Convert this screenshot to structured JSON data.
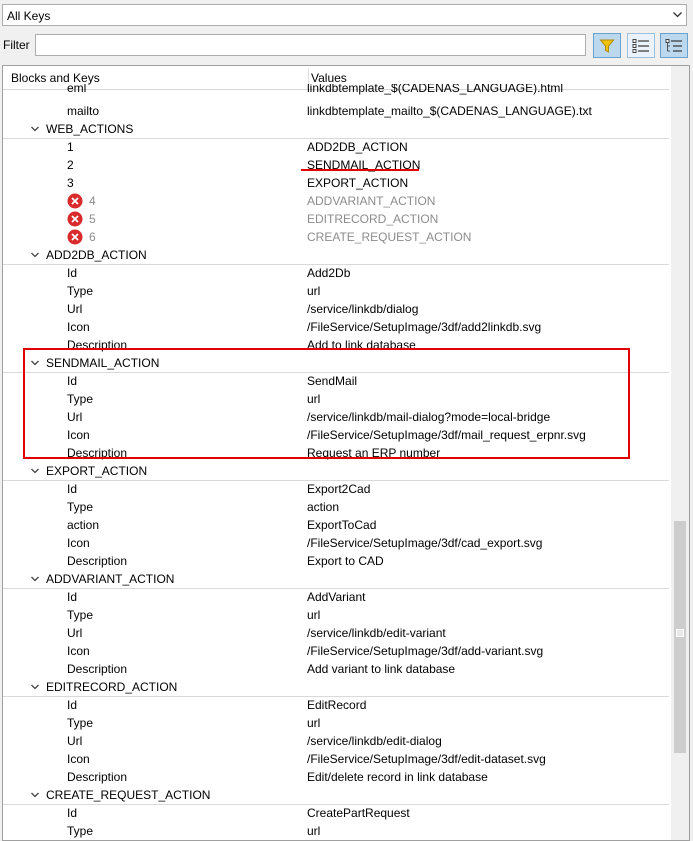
{
  "keyset": {
    "selected": "All Keys"
  },
  "filter": {
    "label": "Filter",
    "value": ""
  },
  "toolbar": {
    "funnel_icon": "filter-funnel-icon",
    "list_icon": "list-view-icon",
    "tree_icon": "tree-view-icon"
  },
  "columns": {
    "keys": "Blocks and Keys",
    "values": "Values"
  },
  "annotation_color": "#e00000",
  "rows": [
    {
      "kind": "child",
      "key": "eml",
      "value": "linkdbtemplate_$(CADENAS_LANGUAGE).html"
    },
    {
      "kind": "child",
      "key": "mailto",
      "value": "linkdbtemplate_mailto_$(CADENAS_LANGUAGE).txt"
    },
    {
      "kind": "group",
      "key": "WEB_ACTIONS",
      "value": ""
    },
    {
      "kind": "child",
      "key": "1",
      "value": "ADD2DB_ACTION"
    },
    {
      "kind": "child",
      "key": "2",
      "value": "SENDMAIL_ACTION"
    },
    {
      "kind": "child",
      "key": "3",
      "value": "EXPORT_ACTION"
    },
    {
      "kind": "error",
      "key": "4",
      "value": "ADDVARIANT_ACTION"
    },
    {
      "kind": "error",
      "key": "5",
      "value": "EDITRECORD_ACTION"
    },
    {
      "kind": "error",
      "key": "6",
      "value": "CREATE_REQUEST_ACTION"
    },
    {
      "kind": "group",
      "key": "ADD2DB_ACTION",
      "value": ""
    },
    {
      "kind": "child",
      "key": "Id",
      "value": "Add2Db"
    },
    {
      "kind": "child",
      "key": "Type",
      "value": "url"
    },
    {
      "kind": "child",
      "key": "Url",
      "value": "/service/linkdb/dialog"
    },
    {
      "kind": "child",
      "key": "Icon",
      "value": "/FileService/SetupImage/3df/add2linkdb.svg"
    },
    {
      "kind": "child",
      "key": "Description",
      "value": "Add to link database"
    },
    {
      "kind": "group",
      "key": "SENDMAIL_ACTION",
      "value": ""
    },
    {
      "kind": "child",
      "key": "Id",
      "value": "SendMail"
    },
    {
      "kind": "child",
      "key": "Type",
      "value": "url"
    },
    {
      "kind": "child",
      "key": "Url",
      "value": "/service/linkdb/mail-dialog?mode=local-bridge"
    },
    {
      "kind": "child",
      "key": "Icon",
      "value": "/FileService/SetupImage/3df/mail_request_erpnr.svg"
    },
    {
      "kind": "child",
      "key": "Description",
      "value": "Request an ERP number"
    },
    {
      "kind": "group",
      "key": "EXPORT_ACTION",
      "value": ""
    },
    {
      "kind": "child",
      "key": "Id",
      "value": "Export2Cad"
    },
    {
      "kind": "child",
      "key": "Type",
      "value": "action"
    },
    {
      "kind": "child",
      "key": "action",
      "value": "ExportToCad"
    },
    {
      "kind": "child",
      "key": "Icon",
      "value": "/FileService/SetupImage/3df/cad_export.svg"
    },
    {
      "kind": "child",
      "key": "Description",
      "value": "Export to CAD"
    },
    {
      "kind": "group",
      "key": "ADDVARIANT_ACTION",
      "value": ""
    },
    {
      "kind": "child",
      "key": "Id",
      "value": "AddVariant"
    },
    {
      "kind": "child",
      "key": "Type",
      "value": "url"
    },
    {
      "kind": "child",
      "key": "Url",
      "value": "/service/linkdb/edit-variant"
    },
    {
      "kind": "child",
      "key": "Icon",
      "value": "/FileService/SetupImage/3df/add-variant.svg"
    },
    {
      "kind": "child",
      "key": "Description",
      "value": "Add variant to link database"
    },
    {
      "kind": "group",
      "key": "EDITRECORD_ACTION",
      "value": ""
    },
    {
      "kind": "child",
      "key": "Id",
      "value": "EditRecord"
    },
    {
      "kind": "child",
      "key": "Type",
      "value": "url"
    },
    {
      "kind": "child",
      "key": "Url",
      "value": "/service/linkdb/edit-dialog"
    },
    {
      "kind": "child",
      "key": "Icon",
      "value": "/FileService/SetupImage/3df/edit-dataset.svg"
    },
    {
      "kind": "child",
      "key": "Description",
      "value": "Edit/delete record in link database"
    },
    {
      "kind": "group",
      "key": "CREATE_REQUEST_ACTION",
      "value": ""
    },
    {
      "kind": "child",
      "key": "Id",
      "value": "CreatePartRequest"
    },
    {
      "kind": "child",
      "key": "Type",
      "value": "url"
    }
  ]
}
